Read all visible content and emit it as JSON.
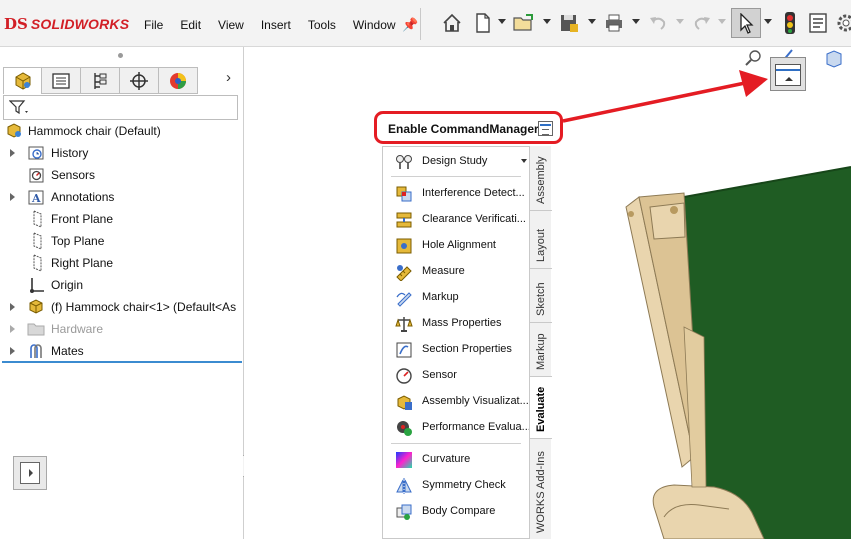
{
  "app": {
    "logo_prefix": "DS",
    "logo_text": "SOLIDWORKS"
  },
  "menu": {
    "items": [
      "File",
      "Edit",
      "View",
      "Insert",
      "Tools",
      "Window"
    ]
  },
  "toolbar": {
    "icons": [
      "home-icon",
      "new-document-icon",
      "open-icon",
      "save-icon",
      "print-icon",
      "undo-icon",
      "redo-icon",
      "select-icon",
      "rebuild-icon",
      "file-properties-icon",
      "options-icon"
    ]
  },
  "tree": {
    "root": "Hammock chair  (Default)",
    "items": [
      {
        "label": "History",
        "icon": "history-icon",
        "expandable": true
      },
      {
        "label": "Sensors",
        "icon": "sensors-icon",
        "expandable": false
      },
      {
        "label": "Annotations",
        "icon": "annotations-icon",
        "expandable": true
      },
      {
        "label": "Front Plane",
        "icon": "plane-icon",
        "expandable": false
      },
      {
        "label": "Top Plane",
        "icon": "plane-icon",
        "expandable": false
      },
      {
        "label": "Right Plane",
        "icon": "plane-icon",
        "expandable": false
      },
      {
        "label": "Origin",
        "icon": "origin-icon",
        "expandable": false
      },
      {
        "label": "(f) Hammock chair<1> (Default<As",
        "icon": "part-icon",
        "expandable": true
      },
      {
        "label": "Hardware",
        "icon": "folder-icon",
        "expandable": true,
        "greyed": true
      },
      {
        "label": "Mates",
        "icon": "mates-icon",
        "expandable": true
      }
    ]
  },
  "commandmanager": {
    "title": "Enable CommandManager",
    "items": [
      {
        "label": "Design Study",
        "icon": "design-study-icon"
      },
      {
        "label": "Interference Detect...",
        "icon": "interference-icon"
      },
      {
        "label": "Clearance Verificati...",
        "icon": "clearance-icon"
      },
      {
        "label": "Hole Alignment",
        "icon": "hole-alignment-icon"
      },
      {
        "label": "Measure",
        "icon": "measure-icon"
      },
      {
        "label": "Markup",
        "icon": "markup-icon"
      },
      {
        "label": "Mass Properties",
        "icon": "mass-properties-icon"
      },
      {
        "label": "Section Properties",
        "icon": "section-properties-icon"
      },
      {
        "label": "Sensor",
        "icon": "sensor-icon"
      },
      {
        "label": "Assembly Visualizat...",
        "icon": "assembly-visualization-icon"
      },
      {
        "label": "Performance Evalua...",
        "icon": "performance-icon"
      },
      {
        "label": "Curvature",
        "icon": "curvature-icon"
      },
      {
        "label": "Symmetry Check",
        "icon": "symmetry-icon"
      },
      {
        "label": "Body Compare",
        "icon": "body-compare-icon"
      }
    ],
    "tabs": [
      "Assembly",
      "Layout",
      "Sketch",
      "Markup",
      "Evaluate",
      "WORKS Add-Ins"
    ],
    "active_tab": "Evaluate"
  },
  "colors": {
    "accent_red": "#e41c23",
    "tree_line": "#3b8bd0",
    "fabric": "#1f5c23",
    "wood": "#e9d5ae"
  }
}
